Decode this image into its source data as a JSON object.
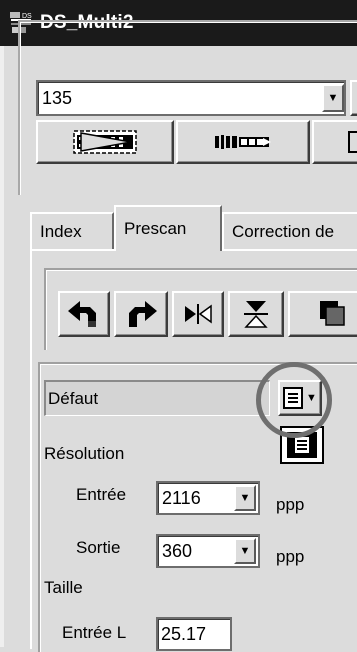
{
  "window": {
    "title": "DS_Multi2",
    "icon": "film-scanner-icon"
  },
  "film": {
    "selected": "135",
    "buttons": [
      {
        "name": "film-advance-button",
        "icon": "film-strip-play-icon"
      },
      {
        "name": "film-index-button",
        "icon": "film-thumbnails-icon"
      },
      {
        "name": "film-third-button",
        "icon": "film-button-icon"
      }
    ]
  },
  "tabs": [
    {
      "label": "Index",
      "active": false
    },
    {
      "label": "Prescan",
      "active": true
    },
    {
      "label": "Correction de",
      "active": false
    }
  ],
  "tools": [
    {
      "name": "rotate-left-button",
      "icon": "rotate-left-icon"
    },
    {
      "name": "rotate-right-button",
      "icon": "rotate-right-icon"
    },
    {
      "name": "flip-horizontal-button",
      "icon": "flip-horizontal-icon"
    },
    {
      "name": "flip-vertical-button",
      "icon": "flip-vertical-icon"
    },
    {
      "name": "copy-button",
      "icon": "copy-icon"
    }
  ],
  "settings": {
    "preset": "Défaut",
    "menu_button_icon": "list-menu-icon",
    "popup_icon": "list-menu-icon",
    "resolution_label": "Résolution",
    "input_label": "Entrée",
    "input_value": "2116",
    "input_unit": "ppp",
    "output_label": "Sortie",
    "output_value": "360",
    "output_unit": "ppp",
    "size_label": "Taille",
    "input_width_label": "Entrée L",
    "input_width_value": "25.17"
  }
}
